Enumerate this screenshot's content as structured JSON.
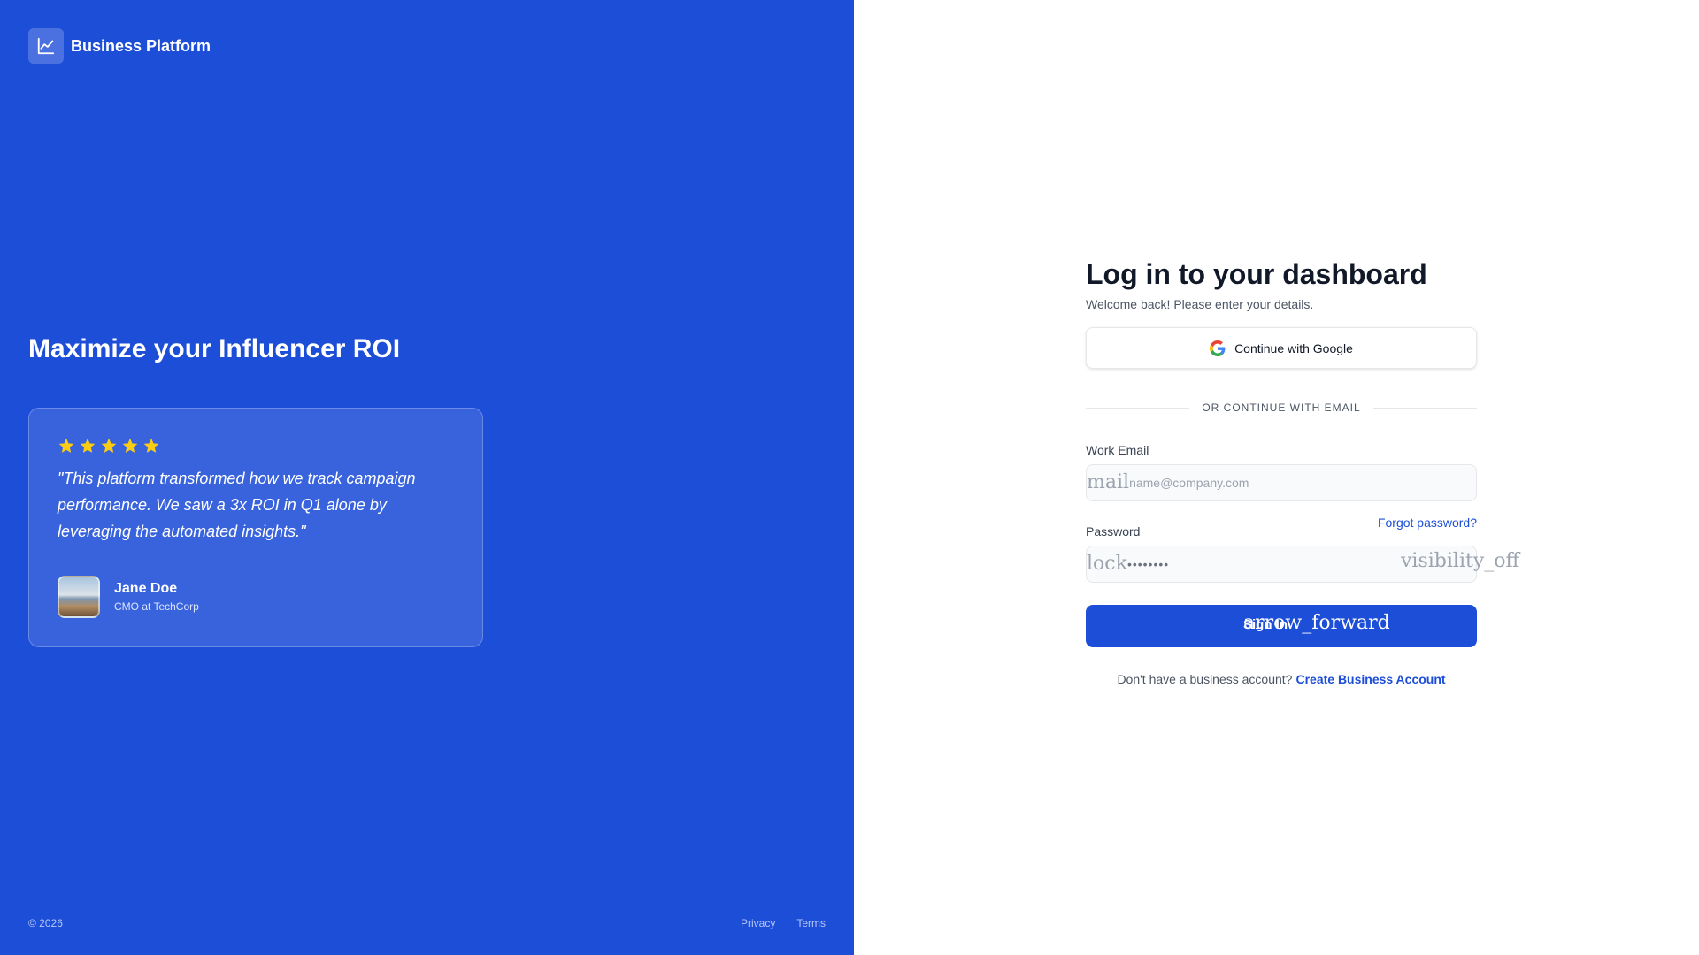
{
  "brand": {
    "name": "Business Platform",
    "icon": "chart-line-icon"
  },
  "hero": {
    "title": "Maximize your Influencer ROI"
  },
  "testimonial": {
    "rating": 5,
    "quote": "\"This platform transformed how we track campaign performance. We saw a 3x ROI in Q1 alone by leveraging the automated insights.\"",
    "author_name": "Jane Doe",
    "author_role": "CMO at TechCorp"
  },
  "footer": {
    "copyright": "© 2026",
    "privacy": "Privacy",
    "terms": "Terms"
  },
  "login": {
    "title": "Log in to your dashboard",
    "subtitle": "Welcome back! Please enter your details.",
    "google_button": "Continue with Google",
    "divider": "OR CONTINUE WITH EMAIL",
    "email_label": "Work Email",
    "email_icon": "mail",
    "email_placeholder": "name@company.com",
    "password_label": "Password",
    "forgot_password": "Forgot password?",
    "password_icon": "lock",
    "password_value": "••••••••",
    "visibility_icon": "visibility_off",
    "signin_label": "Sign In",
    "signin_icon": "arrow_forward",
    "no_account_text": "Don't have a business account?",
    "create_account": "Create Business Account"
  },
  "colors": {
    "primary": "#1d4ed8",
    "star": "#facc15",
    "text_dark": "#111827",
    "text_muted": "#4b5563"
  }
}
